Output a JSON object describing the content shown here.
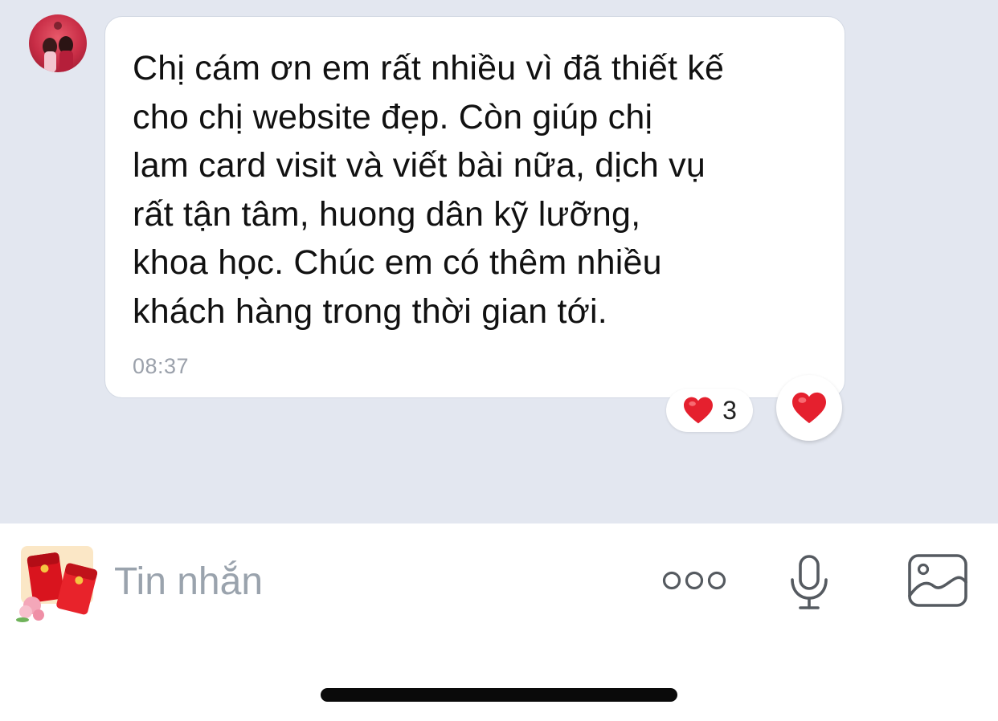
{
  "conversation": {
    "message": {
      "text": "Chị cám ơn em rất nhiều vì đã thiết kế\ncho chị website đẹp. Còn giúp chị\nlam card visit và viết bài nữa, dịch vụ\nrất tận tâm, huong dân kỹ lưỡng,\nkhoa học. Chúc em có thêm nhiều\nkhách hàng trong thời gian tới.",
      "time": "08:37",
      "reaction_icon": "heart-icon",
      "reaction_count": "3"
    }
  },
  "composer": {
    "placeholder": "Tin nhắn",
    "value": "",
    "icons": [
      "sticker-icon",
      "more-icon",
      "microphone-icon",
      "image-icon"
    ]
  },
  "colors": {
    "chat_background": "#e3e7f0",
    "bubble_background": "#ffffff",
    "heart": "#e5202e",
    "icon_gray": "#555a60"
  }
}
